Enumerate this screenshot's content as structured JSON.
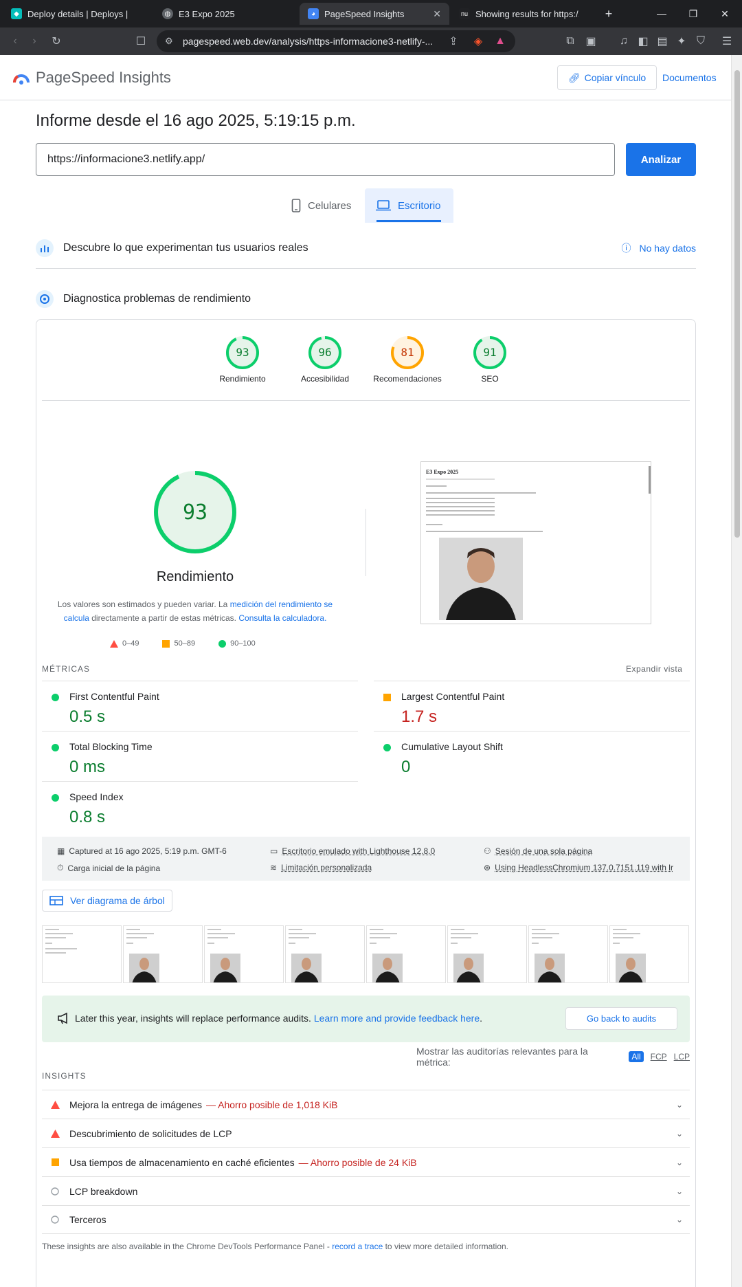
{
  "browser": {
    "tabs": [
      {
        "title": "Deploy details | Deploys | inform"
      },
      {
        "title": "E3 Expo 2025"
      },
      {
        "title": "PageSpeed Insights"
      },
      {
        "title": "Showing results for https://infor"
      }
    ],
    "url": "pagespeed.web.dev/analysis/https-informacione3-netlify-...",
    "brave_badge": "2"
  },
  "header": {
    "brand": "PageSpeed Insights",
    "copy_link": "Copiar vínculo",
    "docs": "Documentos"
  },
  "report": {
    "title": "Informe desde el 16 ago 2025, 5:19:15 p.m.",
    "url_value": "https://informacione3.netlify.app/",
    "analyze": "Analizar",
    "tab_mobile": "Celulares",
    "tab_desktop": "Escritorio"
  },
  "crux": {
    "title": "Descubre lo que experimentan tus usuarios reales",
    "no_data": "No hay datos"
  },
  "diagnose": {
    "title": "Diagnostica problemas de rendimiento"
  },
  "scores": [
    {
      "value": "93",
      "label": "Rendimiento",
      "color": "#0cce6b",
      "fill": 0.93
    },
    {
      "value": "96",
      "label": "Accesibilidad",
      "color": "#0cce6b",
      "fill": 0.96
    },
    {
      "value": "81",
      "label": "Recomendaciones",
      "color": "#ffa400",
      "fill": 0.81
    },
    {
      "value": "91",
      "label": "SEO",
      "color": "#0cce6b",
      "fill": 0.91
    }
  ],
  "performance": {
    "score": "93",
    "label": "Rendimiento",
    "disclaimer_1": "Los valores son estimados y pueden variar. La ",
    "disclaimer_link1": "medición del rendimiento se calcula",
    "disclaimer_2": " directamente a partir de estas métricas. ",
    "disclaimer_link2": "Consulta la calculadora.",
    "legend": [
      "0–49",
      "50–89",
      "90–100"
    ]
  },
  "screenshot_page": {
    "title": "E3 Expo 2025"
  },
  "metrics": {
    "title": "MÉTRICAS",
    "expand": "Expandir vista",
    "items": [
      {
        "name": "First Contentful Paint",
        "value": "0.5 s",
        "status": "good"
      },
      {
        "name": "Largest Contentful Paint",
        "value": "1.7 s",
        "status": "average"
      },
      {
        "name": "Total Blocking Time",
        "value": "0 ms",
        "status": "good"
      },
      {
        "name": "Cumulative Layout Shift",
        "value": "0",
        "status": "good"
      },
      {
        "name": "Speed Index",
        "value": "0.8 s",
        "status": "good"
      }
    ]
  },
  "run_info": {
    "captured": "Captured at 16 ago 2025, 5:19 p.m. GMT-6",
    "load": "Carga inicial de la página",
    "emulated": "Escritorio emulado with Lighthouse 12.8.0",
    "throttling": "Limitación personalizada",
    "session": "Sesión de una sola página",
    "browser": "Using HeadlessChromium 137.0.7151.119 with lr"
  },
  "tree_button": "Ver diagrama de árbol",
  "notice": {
    "text": "Later this year, insights will replace performance audits. ",
    "link": "Learn more and provide feedback here",
    "after": ".",
    "button": "Go back to audits"
  },
  "filter": {
    "label": "Mostrar las auditorías relevantes para la métrica:",
    "all": "All",
    "fcp": "FCP",
    "lcp": "LCP"
  },
  "insights": {
    "title": "INSIGHTS",
    "items": [
      {
        "label": "Mejora la entrega de imágenes",
        "saving": "— Ahorro posible de 1,018 KiB",
        "status": "fail"
      },
      {
        "label": "Descubrimiento de solicitudes de LCP",
        "saving": "",
        "status": "fail"
      },
      {
        "label": "Usa tiempos de almacenamiento en caché eficientes",
        "saving": "— Ahorro posible de 24 KiB",
        "status": "average"
      },
      {
        "label": "LCP breakdown",
        "saving": "",
        "status": "info"
      },
      {
        "label": "Terceros",
        "saving": "",
        "status": "info"
      }
    ],
    "footnote_1": "These insights are also available in the Chrome DevTools Performance Panel - ",
    "footnote_link": "record a trace",
    "footnote_2": " to view more detailed information."
  }
}
